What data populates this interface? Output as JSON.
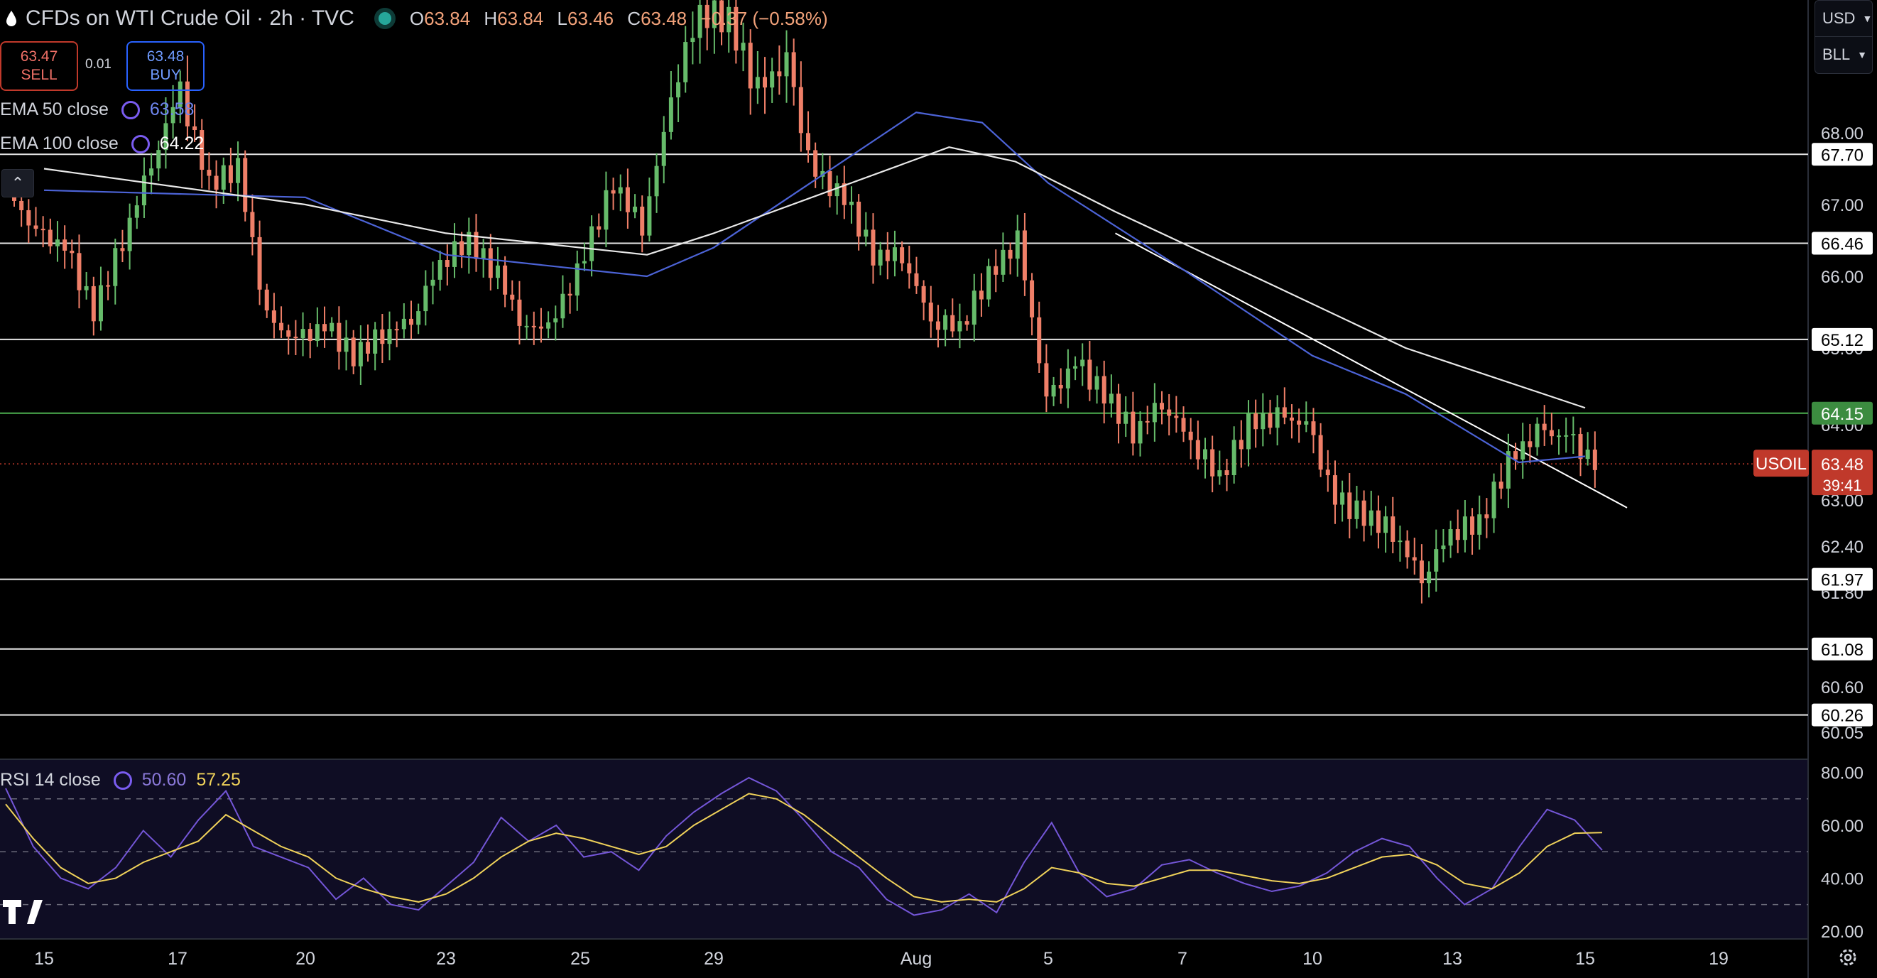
{
  "header": {
    "title": "CFDs on WTI Crude Oil · 2h · TVC",
    "ohlc": [
      {
        "label": "O",
        "value": "63.84"
      },
      {
        "label": "H",
        "value": "63.84"
      },
      {
        "label": "L",
        "value": "63.46"
      },
      {
        "label": "C",
        "value": "63.48"
      }
    ],
    "change": "−0.37 (−0.58%)"
  },
  "trade": {
    "sell_price": "63.47",
    "sell_label": "SELL",
    "spread": "0.01",
    "buy_price": "63.48",
    "buy_label": "BUY"
  },
  "indicators": {
    "ema50_label": "EMA 50 close",
    "ema50_value": "63.58",
    "ema100_label": "EMA 100 close",
    "ema100_value": "64.22",
    "rsi_label": "RSI 14 close",
    "rsi_value": "50.60",
    "rsi_ma_value": "57.25"
  },
  "selectors": {
    "currency": "USD",
    "unit": "BLL"
  },
  "price_label": {
    "symbol": "USOIL",
    "price": "63.48",
    "countdown": "39:41"
  },
  "colors": {
    "up": "#66bb6a",
    "down": "#ef7f68",
    "ema50": "#4c63d6",
    "ema100": "#e8e8e8",
    "rsi": "#7456d8",
    "rsi_ma": "#f0d25a",
    "current_price": "#c0392b",
    "level_green": "#4caf50"
  },
  "chart_data": [
    {
      "type": "candlestick",
      "title": "CFDs on WTI Crude Oil · 2h · TVC",
      "x_ticks": [
        "15",
        "17",
        "20",
        "23",
        "25",
        "29",
        "Aug",
        "5",
        "7",
        "10",
        "13",
        "15",
        "19"
      ],
      "y_axis_ticks": [
        "68.00",
        "67.00",
        "66.00",
        "65.00",
        "64.00",
        "63.00",
        "62.40",
        "61.80",
        "60.60",
        "60.05"
      ],
      "ylim": [
        59.9,
        69.3
      ],
      "horizontal_levels": [
        {
          "value": 67.7,
          "label": "67.70",
          "color": "white"
        },
        {
          "value": 66.46,
          "label": "66.46",
          "color": "white"
        },
        {
          "value": 65.12,
          "label": "65.12",
          "color": "white"
        },
        {
          "value": 64.15,
          "label": "64.15",
          "color": "green"
        },
        {
          "value": 61.97,
          "label": "61.97",
          "color": "white"
        },
        {
          "value": 61.08,
          "label": "61.08",
          "color": "white"
        },
        {
          "value": 60.26,
          "label": "60.26",
          "color": "white"
        }
      ],
      "current_price": 63.48,
      "trendline": [
        {
          "x": "Aug 6",
          "y": 66.6
        },
        {
          "x": "Aug 17",
          "y": 62.9
        }
      ],
      "close_series": [
        {
          "t": "Jul 15",
          "close": 67.2
        },
        {
          "t": "Jul 16",
          "close": 66.6
        },
        {
          "t": "Jul 17",
          "close": 66.4
        },
        {
          "t": "Jul 18",
          "close": 65.5
        },
        {
          "t": "Jul 18b",
          "close": 66.5
        },
        {
          "t": "Jul 19",
          "close": 67.6
        },
        {
          "t": "Jul 19b",
          "close": 68.5
        },
        {
          "t": "Jul 20",
          "close": 67.3
        },
        {
          "t": "Jul 20b",
          "close": 67.5
        },
        {
          "t": "Jul 21",
          "close": 65.4
        },
        {
          "t": "Jul 22",
          "close": 65.1
        },
        {
          "t": "Jul 22b",
          "close": 65.3
        },
        {
          "t": "Jul 23",
          "close": 64.9
        },
        {
          "t": "Jul 23b",
          "close": 65.2
        },
        {
          "t": "Jul 24",
          "close": 65.4
        },
        {
          "t": "Jul 24b",
          "close": 66.2
        },
        {
          "t": "Jul 25",
          "close": 66.5
        },
        {
          "t": "Jul 25b",
          "close": 66.0
        },
        {
          "t": "Jul 26",
          "close": 65.2
        },
        {
          "t": "Jul 27",
          "close": 65.4
        },
        {
          "t": "Jul 28",
          "close": 66.3
        },
        {
          "t": "Jul 28b",
          "close": 67.3
        },
        {
          "t": "Jul 29",
          "close": 66.7
        },
        {
          "t": "Jul 29b",
          "close": 68.4
        },
        {
          "t": "Jul 30",
          "close": 69.2
        },
        {
          "t": "Jul 31",
          "close": 69.1
        },
        {
          "t": "Aug 1",
          "close": 68.4
        },
        {
          "t": "Aug 2",
          "close": 68.7
        },
        {
          "t": "Aug 3",
          "close": 67.4
        },
        {
          "t": "Aug 3b",
          "close": 67.1
        },
        {
          "t": "Aug 4",
          "close": 66.3
        },
        {
          "t": "Aug 4b",
          "close": 66.3
        },
        {
          "t": "Aug 5",
          "close": 65.4
        },
        {
          "t": "Aug 5b",
          "close": 65.3
        },
        {
          "t": "Aug 6",
          "close": 66.0
        },
        {
          "t": "Aug 6b",
          "close": 66.5
        },
        {
          "t": "Aug 6c",
          "close": 64.3
        },
        {
          "t": "Aug 7",
          "close": 64.8
        },
        {
          "t": "Aug 7b",
          "close": 64.4
        },
        {
          "t": "Aug 8",
          "close": 63.9
        },
        {
          "t": "Aug 8b",
          "close": 64.3
        },
        {
          "t": "Aug 9",
          "close": 63.8
        },
        {
          "t": "Aug 10",
          "close": 63.3
        },
        {
          "t": "Aug 10b",
          "close": 64.0
        },
        {
          "t": "Aug 11",
          "close": 64.1
        },
        {
          "t": "Aug 11b",
          "close": 64.0
        },
        {
          "t": "Aug 12",
          "close": 63.0
        },
        {
          "t": "Aug 12b",
          "close": 62.8
        },
        {
          "t": "Aug 13",
          "close": 62.6
        },
        {
          "t": "Aug 13b",
          "close": 62.0
        },
        {
          "t": "Aug 14",
          "close": 62.6
        },
        {
          "t": "Aug 14b",
          "close": 62.7
        },
        {
          "t": "Aug 14c",
          "close": 63.5
        },
        {
          "t": "Aug 15",
          "close": 63.9
        },
        {
          "t": "Aug 15b",
          "close": 63.84
        },
        {
          "t": "Aug 15c",
          "close": 63.48
        }
      ],
      "ema50": [
        {
          "t": "Jul 15",
          "v": 67.2
        },
        {
          "t": "Jul 20",
          "v": 67.1
        },
        {
          "t": "Jul 23",
          "v": 66.3
        },
        {
          "t": "Jul 27",
          "v": 66.0
        },
        {
          "t": "Jul 29",
          "v": 66.4
        },
        {
          "t": "Aug 1",
          "v": 68.2
        },
        {
          "t": "Aug 3",
          "v": 68.1
        },
        {
          "t": "Aug 5",
          "v": 67.3
        },
        {
          "t": "Aug 7",
          "v": 66.1
        },
        {
          "t": "Aug 10",
          "v": 64.9
        },
        {
          "t": "Aug 12",
          "v": 64.4
        },
        {
          "t": "Aug 14",
          "v": 63.5
        },
        {
          "t": "Aug 15",
          "v": 63.58
        }
      ],
      "ema100": [
        {
          "t": "Jul 15",
          "v": 67.5
        },
        {
          "t": "Jul 20",
          "v": 67.0
        },
        {
          "t": "Jul 23",
          "v": 66.6
        },
        {
          "t": "Jul 27",
          "v": 66.3
        },
        {
          "t": "Jul 29",
          "v": 66.6
        },
        {
          "t": "Aug 2",
          "v": 67.8
        },
        {
          "t": "Aug 4",
          "v": 67.6
        },
        {
          "t": "Aug 6",
          "v": 66.9
        },
        {
          "t": "Aug 9",
          "v": 65.9
        },
        {
          "t": "Aug 12",
          "v": 65.0
        },
        {
          "t": "Aug 15",
          "v": 64.22
        }
      ]
    },
    {
      "type": "line",
      "title": "RSI 14 close",
      "y_axis_ticks": [
        "80.00",
        "60.00",
        "40.00",
        "20.00"
      ],
      "ylim": [
        17,
        85
      ],
      "bands": [
        70,
        50,
        30
      ],
      "series": [
        {
          "name": "RSI",
          "values": [
            74,
            52,
            40,
            36,
            44,
            58,
            48,
            62,
            73,
            52,
            48,
            44,
            32,
            40,
            30,
            28,
            37,
            46,
            63,
            54,
            60,
            48,
            50,
            43,
            56,
            65,
            72,
            78,
            73,
            62,
            50,
            44,
            32,
            26,
            28,
            34,
            27,
            46,
            61,
            42,
            33,
            36,
            45,
            47,
            42,
            38,
            35,
            37,
            42,
            50,
            55,
            52,
            40,
            30,
            36,
            52,
            66,
            62,
            50.6
          ]
        },
        {
          "name": "RSI MA",
          "values": [
            68,
            55,
            44,
            38,
            40,
            46,
            50,
            54,
            64,
            58,
            52,
            48,
            40,
            36,
            33,
            31,
            34,
            40,
            48,
            54,
            57,
            55,
            52,
            49,
            52,
            60,
            66,
            72,
            70,
            64,
            56,
            48,
            40,
            33,
            31,
            32,
            31,
            36,
            44,
            42,
            38,
            37,
            40,
            43,
            43,
            41,
            39,
            38,
            40,
            44,
            48,
            49,
            45,
            38,
            36,
            42,
            52,
            57,
            57.25
          ]
        }
      ]
    }
  ]
}
